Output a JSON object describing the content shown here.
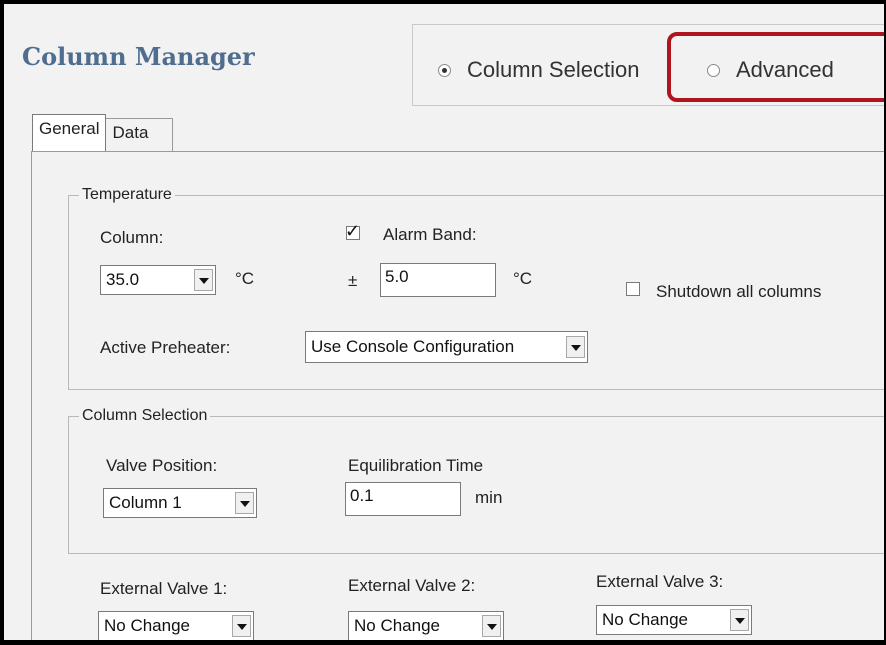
{
  "header": {
    "title": "Column Manager"
  },
  "mode": {
    "options": [
      "Column Selection",
      "Advanced"
    ],
    "selected": "Column Selection",
    "highlighted": "Advanced",
    "highlight_color": "#b0141e"
  },
  "tabs": [
    {
      "label": "General",
      "active": true
    },
    {
      "label": "Data",
      "active": false
    }
  ],
  "temperature": {
    "legend": "Temperature",
    "column_label": "Column:",
    "column_value": "35.0",
    "column_unit": "°C",
    "alarm_band_label": "Alarm Band:",
    "alarm_band_checked": true,
    "alarm_band_prefix": "±",
    "alarm_band_value": "5.0",
    "alarm_band_unit": "°C",
    "shutdown_label": "Shutdown all columns",
    "shutdown_checked": false,
    "preheater_label": "Active Preheater:",
    "preheater_value": "Use Console Configuration"
  },
  "column_selection": {
    "legend": "Column Selection",
    "valve_position_label": "Valve Position:",
    "valve_position_value": "Column 1",
    "equilibration_label": "Equilibration Time",
    "equilibration_value": "0.1",
    "equilibration_unit": "min"
  },
  "external_valves": [
    {
      "label": "External Valve 1:",
      "value": "No Change"
    },
    {
      "label": "External Valve 2:",
      "value": "No Change"
    },
    {
      "label": "External Valve 3:",
      "value": "No Change"
    }
  ],
  "check_glyph": "✓",
  "colors": {
    "title": "#4e6d8f",
    "highlight": "#b0141e",
    "background": "#f2f2f2"
  }
}
